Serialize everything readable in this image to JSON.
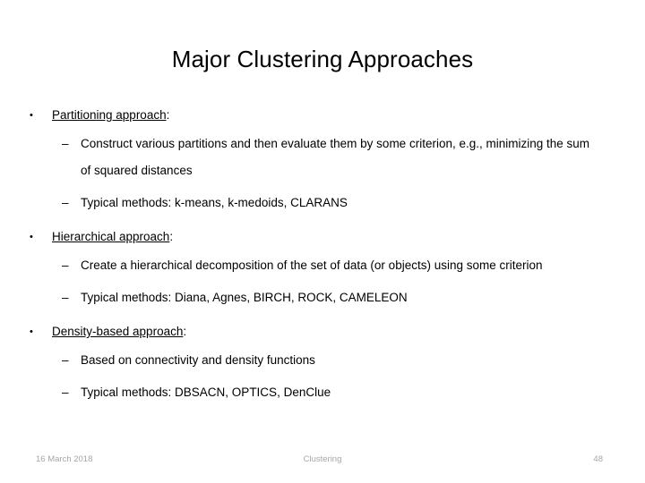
{
  "slide": {
    "title": "Major Clustering Approaches",
    "bullet_glyph": "•",
    "dash_glyph": "–",
    "text_color": "#000000",
    "footer_color": "#a6a6a6",
    "background_color": "#ffffff"
  },
  "groups": [
    {
      "heading_underlined": "Partitioning approach",
      "heading_suffix": ":",
      "subitems": [
        "Construct various partitions and then evaluate them by some criterion, e.g., minimizing the sum of squared distances",
        "Typical methods: k-means, k-medoids, CLARANS"
      ]
    },
    {
      "heading_underlined": "Hierarchical approach",
      "heading_suffix": ":",
      "subitems": [
        "Create a hierarchical decomposition of the set of data (or objects) using some criterion",
        "Typical methods: Diana, Agnes, BIRCH, ROCK, CAMELEON"
      ]
    },
    {
      "heading_underlined": "Density-based approach",
      "heading_suffix": ":",
      "subitems": [
        "Based on connectivity and density functions",
        "Typical methods: DBSACN, OPTICS, DenClue"
      ]
    }
  ],
  "footer": {
    "date": "16 March 2018",
    "center": "Clustering",
    "page_number": "48"
  }
}
